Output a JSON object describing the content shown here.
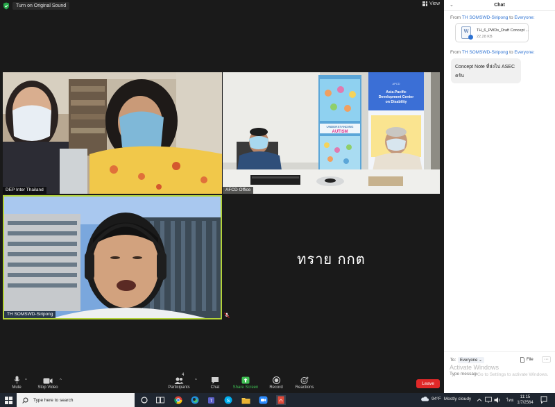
{
  "meeting": {
    "original_sound_label": "Turn on Original Sound",
    "view_label": "View",
    "tiles": [
      {
        "name": "DEP Inter Thailand"
      },
      {
        "name": "AFCD Office"
      },
      {
        "name": "TH SOMSWD-Siripong",
        "active_speaker": true
      },
      {
        "name": "ทราย กกต",
        "video_off": true
      }
    ],
    "afcd_poster": {
      "poster_left_title": "UNDERSTANDING AUTISM",
      "poster_right_title": "Asia-Pacific Development Center on Disability"
    }
  },
  "toolbar": {
    "mute_label": "Mute",
    "stop_video_label": "Stop Video",
    "participants_label": "Participants",
    "participants_count": "4",
    "chat_label": "Chat",
    "share_screen_label": "Share Screen",
    "record_label": "Record",
    "reactions_label": "Reactions",
    "leave_label": "Leave"
  },
  "chat": {
    "title": "Chat",
    "messages": [
      {
        "from_prefix": "From",
        "sender": "TH SOMSWD-Siripong",
        "to_word": "to",
        "recipient": "Everyone:",
        "file_name": "TH_6_PWDs_Draft Concept ...",
        "file_size": "22.28 KB"
      },
      {
        "from_prefix": "From",
        "sender": "TH SOMSWD-Siripong",
        "to_word": "to",
        "recipient": "Everyone:",
        "text_line1": "Concept Note ที่ส่งไป ASEC",
        "text_line2": "ครับ"
      }
    ],
    "to_label": "To:",
    "to_value": "Everyone",
    "file_button": "File",
    "input_placeholder": "Type message here",
    "watermark_title": "Activate Windows",
    "watermark_sub": "Go to Settings to activate Windows."
  },
  "taskbar": {
    "search_placeholder": "Type here to search",
    "temperature": "94°F",
    "weather": "Mostly cloudy",
    "language": "ไทย",
    "time": "11:15",
    "date": "1/7/2564"
  },
  "colors": {
    "active_speaker_border": "#b3d33a",
    "share_green": "#3fbf53",
    "leave_red": "#e02828",
    "link_blue": "#2d72d2"
  }
}
